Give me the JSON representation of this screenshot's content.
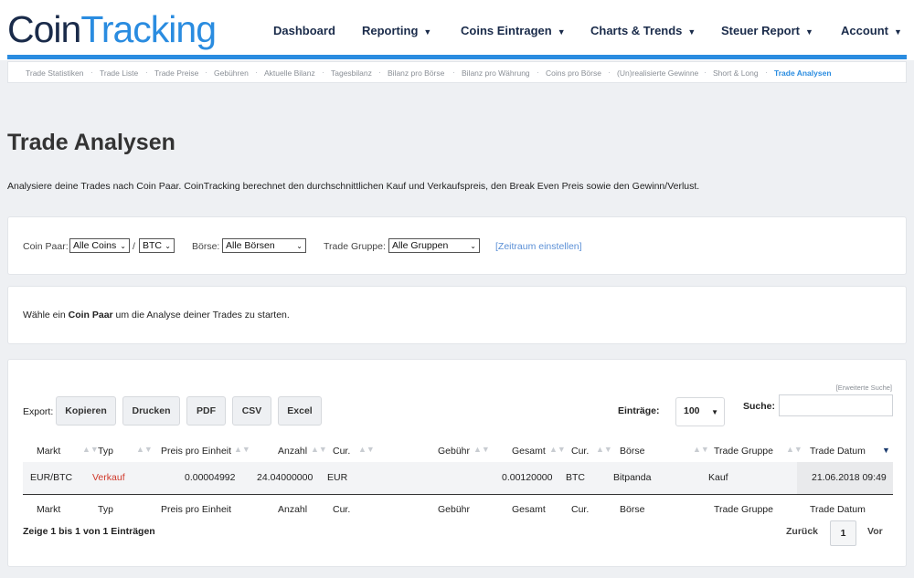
{
  "logo": {
    "part1": "Coin",
    "part2": "Tracking"
  },
  "nav": {
    "dashboard": "Dashboard",
    "reporting": "Reporting",
    "coins_eintragen": "Coins Eintragen",
    "charts_trends": "Charts & Trends",
    "steuer_report": "Steuer Report",
    "account": "Account",
    "caret": "▼"
  },
  "subnav": [
    "Trade Statistiken",
    "Trade Liste",
    "Trade Preise",
    "Gebühren",
    "Aktuelle Bilanz",
    "Tagesbilanz",
    "Bilanz pro Börse",
    "Bilanz pro Währung",
    "Coins pro Börse",
    "(Un)realisierte Gewinne",
    "Short & Long",
    "Trade Analysen"
  ],
  "subnav_separator": "·",
  "page": {
    "title": "Trade Analysen",
    "description": "Analysiere deine Trades nach Coin Paar. CoinTracking berechnet den durchschnittlichen Kauf und Verkaufspreis, den Break Even Preis sowie den Gewinn/Verlust."
  },
  "filters": {
    "coin_paar_label": "Coin Paar:",
    "coin_value": "Alle Coins",
    "slash": "/",
    "currency_value": "BTC",
    "boerse_label": "Börse:",
    "boerse_value": "Alle Börsen",
    "gruppe_label": "Trade Gruppe:",
    "gruppe_value": "Alle Gruppen",
    "zeitraum": "[Zeitraum einstellen]",
    "select_arrow": "⌄"
  },
  "choose": {
    "pre": "Wähle ein ",
    "bold": "Coin Paar",
    "post": " um die Analyse deiner Trades zu starten."
  },
  "table": {
    "erweiterte_suche": "[Erweiterte Suche]",
    "export_label": "Export:",
    "buttons": [
      "Kopieren",
      "Drucken",
      "PDF",
      "CSV",
      "Excel"
    ],
    "entries_label": "Einträge:",
    "entries_value": "100",
    "search_label": "Suche:",
    "columns": [
      "Markt",
      "Typ",
      "Preis pro Einheit",
      "Anzahl",
      "Cur.",
      "Gebühr",
      "Gesamt",
      "Cur.",
      "Börse",
      "Trade Gruppe",
      "Trade Datum"
    ],
    "sort_icon": "▲▼",
    "sort_active": "▼",
    "rows": [
      [
        "EUR/BTC",
        "Verkauf",
        "0.00004992",
        "24.04000000",
        "EUR",
        "",
        "0.00120000",
        "BTC",
        "Bitpanda",
        "Kauf",
        "21.06.2018 09:49"
      ]
    ],
    "info": "Zeige 1 bis 1 von 1 Einträgen",
    "prev": "Zurück",
    "page": "1",
    "next": "Vor"
  },
  "colors": {
    "brand_dark": "#1a2b4a",
    "brand_blue": "#2a8ce0",
    "sell_red": "#d0392b"
  }
}
